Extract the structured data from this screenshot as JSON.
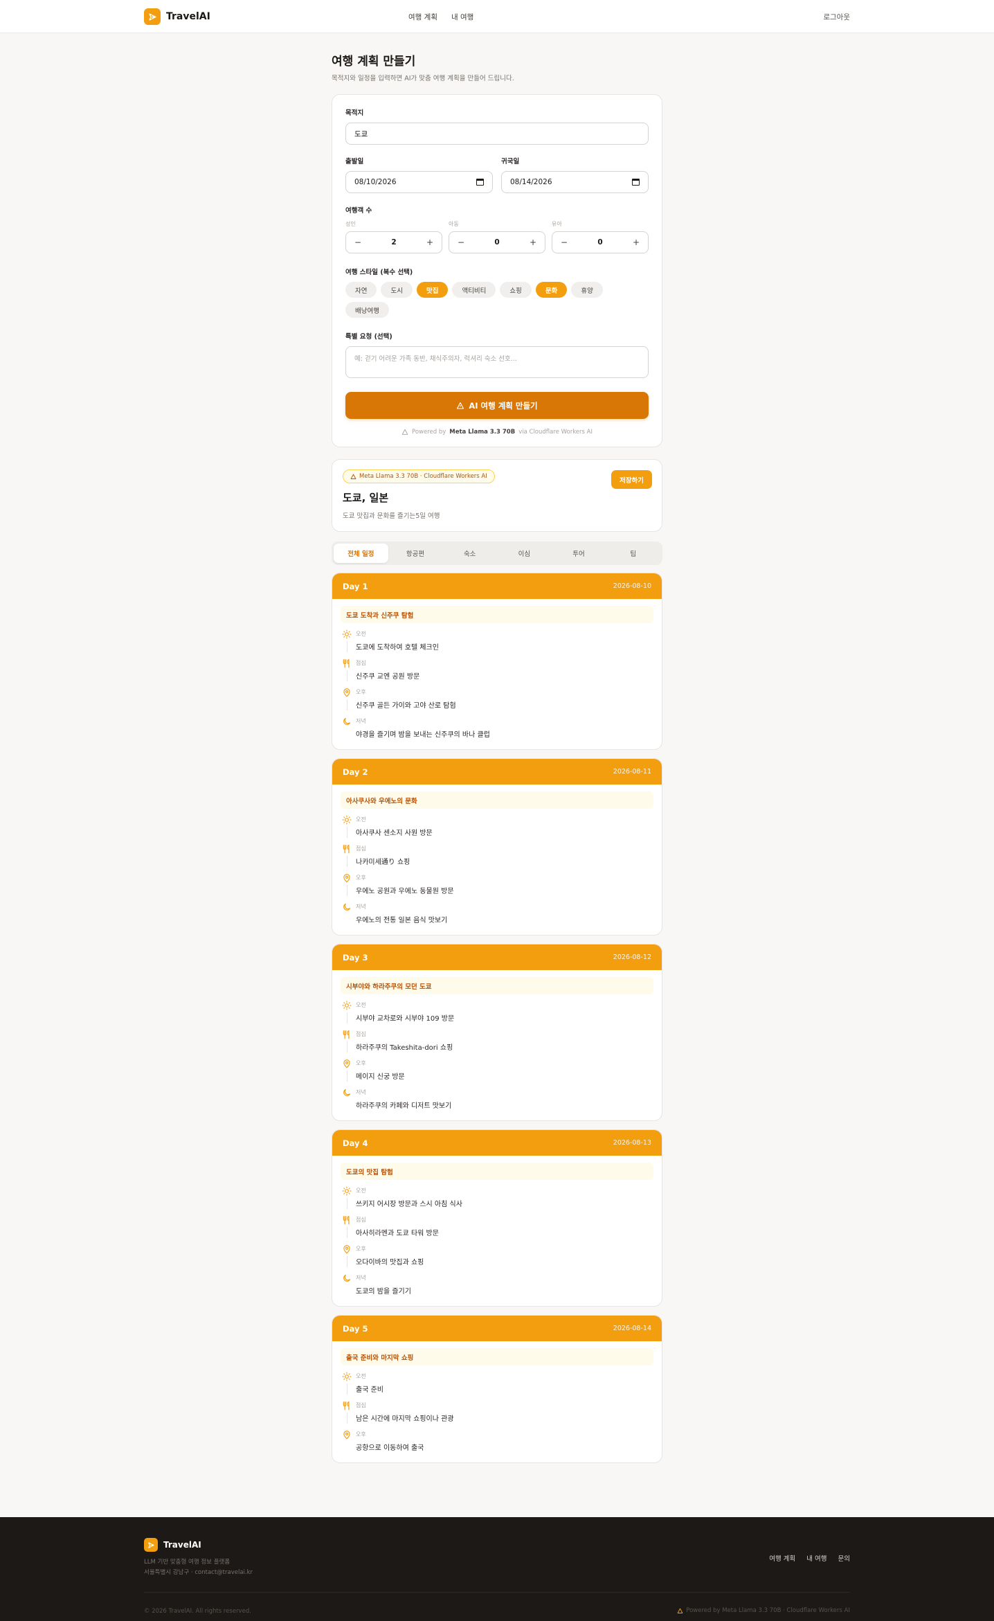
{
  "nav": {
    "brand": "TravelAI",
    "links": [
      "여행 계획",
      "내 여행"
    ],
    "logout": "로그아웃"
  },
  "page": {
    "title": "여행 계획 만들기",
    "subtitle": "목적지와 일정을 입력하면 AI가 맞춤 여행 계획을 만들어 드립니다."
  },
  "form": {
    "destination_label": "목적지",
    "destination_value": "도쿄",
    "depart_label": "출발일",
    "depart_value": "08/10/2026",
    "return_label": "귀국일",
    "return_value": "08/14/2026",
    "travelers_label": "여행객 수",
    "travelers": [
      {
        "label": "성인",
        "value": "2"
      },
      {
        "label": "아동",
        "value": "0"
      },
      {
        "label": "유아",
        "value": "0"
      }
    ],
    "style_label": "여행 스타일 (복수 선택)",
    "styles": [
      {
        "label": "자연",
        "active": false
      },
      {
        "label": "도시",
        "active": false
      },
      {
        "label": "맛집",
        "active": true
      },
      {
        "label": "액티비티",
        "active": false
      },
      {
        "label": "쇼핑",
        "active": false
      },
      {
        "label": "문화",
        "active": true
      },
      {
        "label": "휴양",
        "active": false
      },
      {
        "label": "배낭여행",
        "active": false
      }
    ],
    "request_label": "특별 요청 (선택)",
    "request_placeholder": "예: 걷기 어려운 가족 동반, 채식주의자, 럭셔리 숙소 선호...",
    "submit_label": "AI 여행 계획 만들기",
    "powered_prefix": "Powered by",
    "powered_model": "Meta Llama 3.3 70B",
    "powered_suffix": "via Cloudflare Workers AI"
  },
  "summary": {
    "badge": "Meta Llama 3.3 70B · Cloudflare Workers AI",
    "save_label": "저장하기",
    "title": "도쿄, 일본",
    "description": "도쿄 맛집과 문화를 즐기는5일 여행"
  },
  "tabs": [
    {
      "label": "전체 일정",
      "active": true
    },
    {
      "label": "항공편",
      "active": false
    },
    {
      "label": "숙소",
      "active": false
    },
    {
      "label": "이심",
      "active": false
    },
    {
      "label": "투어",
      "active": false
    },
    {
      "label": "팁",
      "active": false
    }
  ],
  "days": [
    {
      "label": "Day 1",
      "date": "2026-08-10",
      "theme": "도쿄 도착과 신주쿠 탐험",
      "slots": [
        {
          "icon": "sun",
          "time": "오전",
          "text": "도쿄에 도착하여 호텔 체크인"
        },
        {
          "icon": "utensils",
          "time": "점심",
          "text": "신주쿠 교엔 공원 방문"
        },
        {
          "icon": "pin",
          "time": "오후",
          "text": "신주쿠 골든 가이와 고야 산로 탐험"
        },
        {
          "icon": "moon",
          "time": "저녁",
          "text": "야경을 즐기며 밤을 보내는 신주쿠의 바나 클럽"
        }
      ]
    },
    {
      "label": "Day 2",
      "date": "2026-08-11",
      "theme": "아사쿠사와 우에노의 문화",
      "slots": [
        {
          "icon": "sun",
          "time": "오전",
          "text": "아사쿠사 센소지 사원 방문"
        },
        {
          "icon": "utensils",
          "time": "점심",
          "text": "나카미세通り 쇼핑"
        },
        {
          "icon": "pin",
          "time": "오후",
          "text": "우에노 공원과 우에노 동물원 방문"
        },
        {
          "icon": "moon",
          "time": "저녁",
          "text": "우에노의 전통 일본 음식 맛보기"
        }
      ]
    },
    {
      "label": "Day 3",
      "date": "2026-08-12",
      "theme": "시부야와 하라주쿠의 모던 도쿄",
      "slots": [
        {
          "icon": "sun",
          "time": "오전",
          "text": "시부야 교차로와 시부야 109 방문"
        },
        {
          "icon": "utensils",
          "time": "점심",
          "text": "하라주쿠의 Takeshita-dori 쇼핑"
        },
        {
          "icon": "pin",
          "time": "오후",
          "text": "메이지 신궁 방문"
        },
        {
          "icon": "moon",
          "time": "저녁",
          "text": "하라주쿠의 카페와 디저트 맛보기"
        }
      ]
    },
    {
      "label": "Day 4",
      "date": "2026-08-13",
      "theme": "도쿄의 맛집 탐험",
      "slots": [
        {
          "icon": "sun",
          "time": "오전",
          "text": "쓰키지 어시장 방문과 스시 아침 식사"
        },
        {
          "icon": "utensils",
          "time": "점심",
          "text": "아사히라멘과 도쿄 타워 방문"
        },
        {
          "icon": "pin",
          "time": "오후",
          "text": "오다이바의 맛집과 쇼핑"
        },
        {
          "icon": "moon",
          "time": "저녁",
          "text": "도쿄의 밤을 즐기기"
        }
      ]
    },
    {
      "label": "Day 5",
      "date": "2026-08-14",
      "theme": "출국 준비와 마지막 쇼핑",
      "slots": [
        {
          "icon": "sun",
          "time": "오전",
          "text": "출국 준비"
        },
        {
          "icon": "utensils",
          "time": "점심",
          "text": "남은 시간에 마지막 쇼핑이나 관광"
        },
        {
          "icon": "pin",
          "time": "오후",
          "text": "공항으로 이동하여 출국"
        }
      ]
    }
  ],
  "footer": {
    "brand": "TravelAI",
    "description": "LLM 기반 맞춤형 여행 정보 플랫폼",
    "address": "서울특별시 강남구 · contact@travelai.kr",
    "links": [
      "여행 계획",
      "내 여행",
      "문의"
    ],
    "copyright": "© 2026 TravelAI. All rights reserved.",
    "powered": "Powered by Meta Llama 3.3 70B · Cloudflare Workers AI"
  },
  "colors": {
    "accent": "#f29e0f",
    "accent_dark": "#d97706",
    "footer_bg": "#1c1917"
  }
}
